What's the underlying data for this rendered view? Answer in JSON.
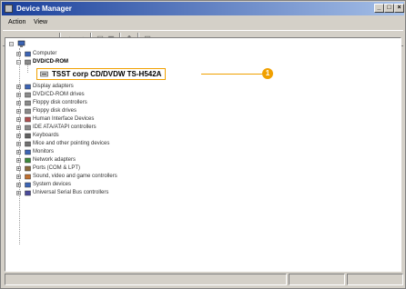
{
  "window": {
    "title": "Device Manager",
    "controls": {
      "minimize": "_",
      "maximize": "□",
      "close": "×"
    }
  },
  "menubar": {
    "items": [
      {
        "label": "Action"
      },
      {
        "label": "View"
      }
    ]
  },
  "toolbar": {
    "buttons": [
      {
        "icon": "back-arrow-icon",
        "glyph": "⇦"
      },
      {
        "icon": "forward-arrow-icon",
        "glyph": "⇨"
      },
      {
        "icon": "tree-view-icon",
        "glyph": "▤"
      },
      {
        "icon": "properties-icon",
        "glyph": "▦"
      },
      {
        "icon": "update-driver-icon",
        "glyph": "⇑"
      },
      {
        "icon": "scan-hardware-icon",
        "glyph": "▣"
      }
    ]
  },
  "tree": {
    "root": {
      "label": ""
    },
    "items": [
      {
        "label": "Computer",
        "icon": "computer-icon"
      },
      {
        "label": "DVD/CD-ROM",
        "icon": "dvd-drive-icon",
        "expanded": true
      },
      {
        "label": "Display adapters",
        "icon": "display-adapter-icon"
      },
      {
        "label": "DVD/CD-ROM drives",
        "icon": "dvd-drive-icon"
      },
      {
        "label": "Floppy disk controllers",
        "icon": "floppy-controller-icon"
      },
      {
        "label": "Floppy disk drives",
        "icon": "floppy-drive-icon"
      },
      {
        "label": "Human Interface Devices",
        "icon": "hid-icon"
      },
      {
        "label": "IDE ATA/ATAPI controllers",
        "icon": "ide-controller-icon"
      },
      {
        "label": "Keyboards",
        "icon": "keyboard-icon"
      },
      {
        "label": "Mice and other pointing devices",
        "icon": "mouse-icon"
      },
      {
        "label": "Monitors",
        "icon": "monitor-icon"
      },
      {
        "label": "Network adapters",
        "icon": "network-adapter-icon"
      },
      {
        "label": "Ports (COM & LPT)",
        "icon": "port-icon"
      },
      {
        "label": "Sound, video and game controllers",
        "icon": "sound-icon"
      },
      {
        "label": "System devices",
        "icon": "system-device-icon"
      },
      {
        "label": "Universal Serial Bus controllers",
        "icon": "usb-icon"
      }
    ],
    "highlighted_child": {
      "label": "TSST corp CD/DVDW TS-H542A",
      "icon": "cd-drive-icon"
    }
  },
  "callout": {
    "number": "1",
    "color": "#f0a000"
  }
}
